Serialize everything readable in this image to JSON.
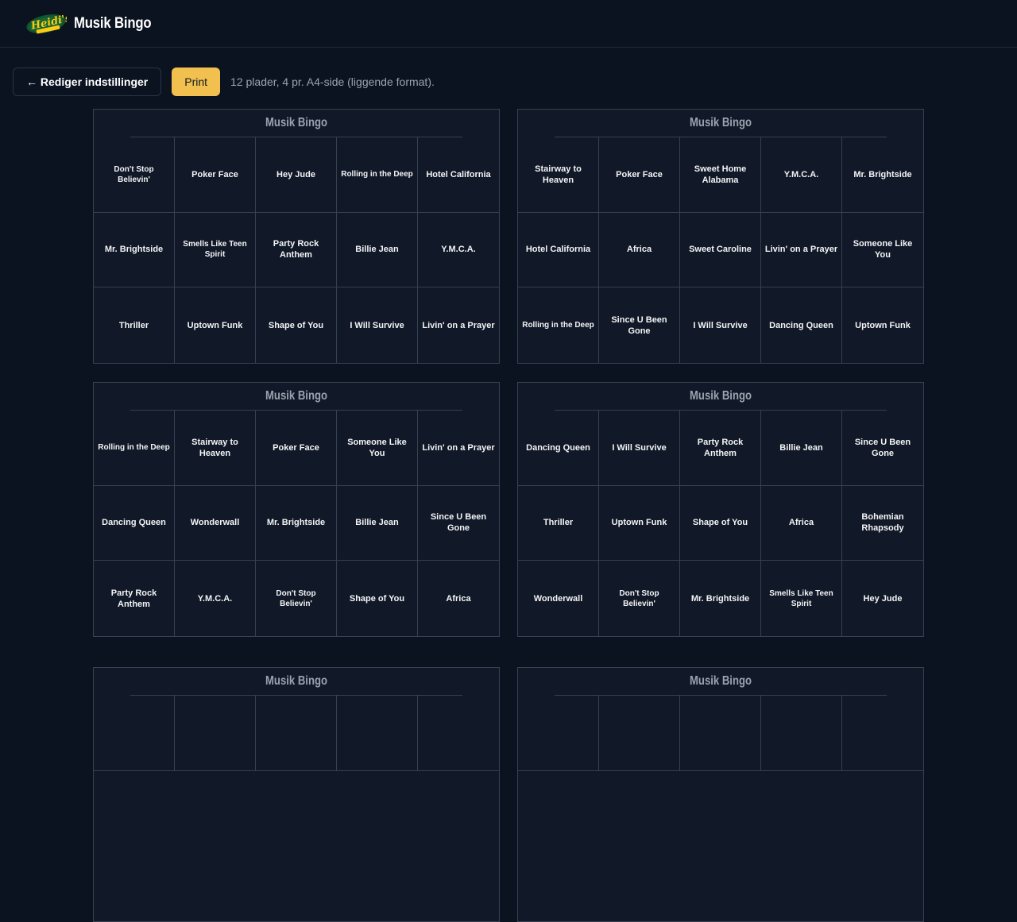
{
  "header": {
    "title": "Musik Bingo",
    "logo_text": "Heidi's Bierbar"
  },
  "toolbar": {
    "back_label": "← Rediger indstillinger",
    "print_label": "Print",
    "info": "12 plader, 4 pr. A4-side (liggende format)."
  },
  "cards": [
    {
      "title": "Musik Bingo",
      "songs": [
        "Don't Stop Believin'",
        "Poker Face",
        "Hey Jude",
        "Rolling in the Deep",
        "Hotel California",
        "Mr. Brightside",
        "Smells Like Teen Spirit",
        "Party Rock Anthem",
        "Billie Jean",
        "Y.M.C.A.",
        "Thriller",
        "Uptown Funk",
        "Shape of You",
        "I Will Survive",
        "Livin' on a Prayer"
      ]
    },
    {
      "title": "Musik Bingo",
      "songs": [
        "Stairway to Heaven",
        "Poker Face",
        "Sweet Home Alabama",
        "Y.M.C.A.",
        "Mr. Brightside",
        "Hotel California",
        "Africa",
        "Sweet Caroline",
        "Livin' on a Prayer",
        "Someone Like You",
        "Rolling in the Deep",
        "Since U Been Gone",
        "I Will Survive",
        "Dancing Queen",
        "Uptown Funk"
      ]
    },
    {
      "title": "Musik Bingo",
      "songs": [
        "Rolling in the Deep",
        "Stairway to Heaven",
        "Poker Face",
        "Someone Like You",
        "Livin' on a Prayer",
        "Dancing Queen",
        "Wonderwall",
        "Mr. Brightside",
        "Billie Jean",
        "Since U Been Gone",
        "Party Rock Anthem",
        "Y.M.C.A.",
        "Don't Stop Believin'",
        "Shape of You",
        "Africa"
      ]
    },
    {
      "title": "Musik Bingo",
      "songs": [
        "Dancing Queen",
        "I Will Survive",
        "Party Rock Anthem",
        "Billie Jean",
        "Since U Been Gone",
        "Thriller",
        "Uptown Funk",
        "Shape of You",
        "Africa",
        "Bohemian Rhapsody",
        "Wonderwall",
        "Don't Stop Believin'",
        "Mr. Brightside",
        "Smells Like Teen Spirit",
        "Hey Jude"
      ]
    },
    {
      "title": "Musik Bingo",
      "songs": []
    },
    {
      "title": "Musik Bingo",
      "songs": []
    }
  ]
}
